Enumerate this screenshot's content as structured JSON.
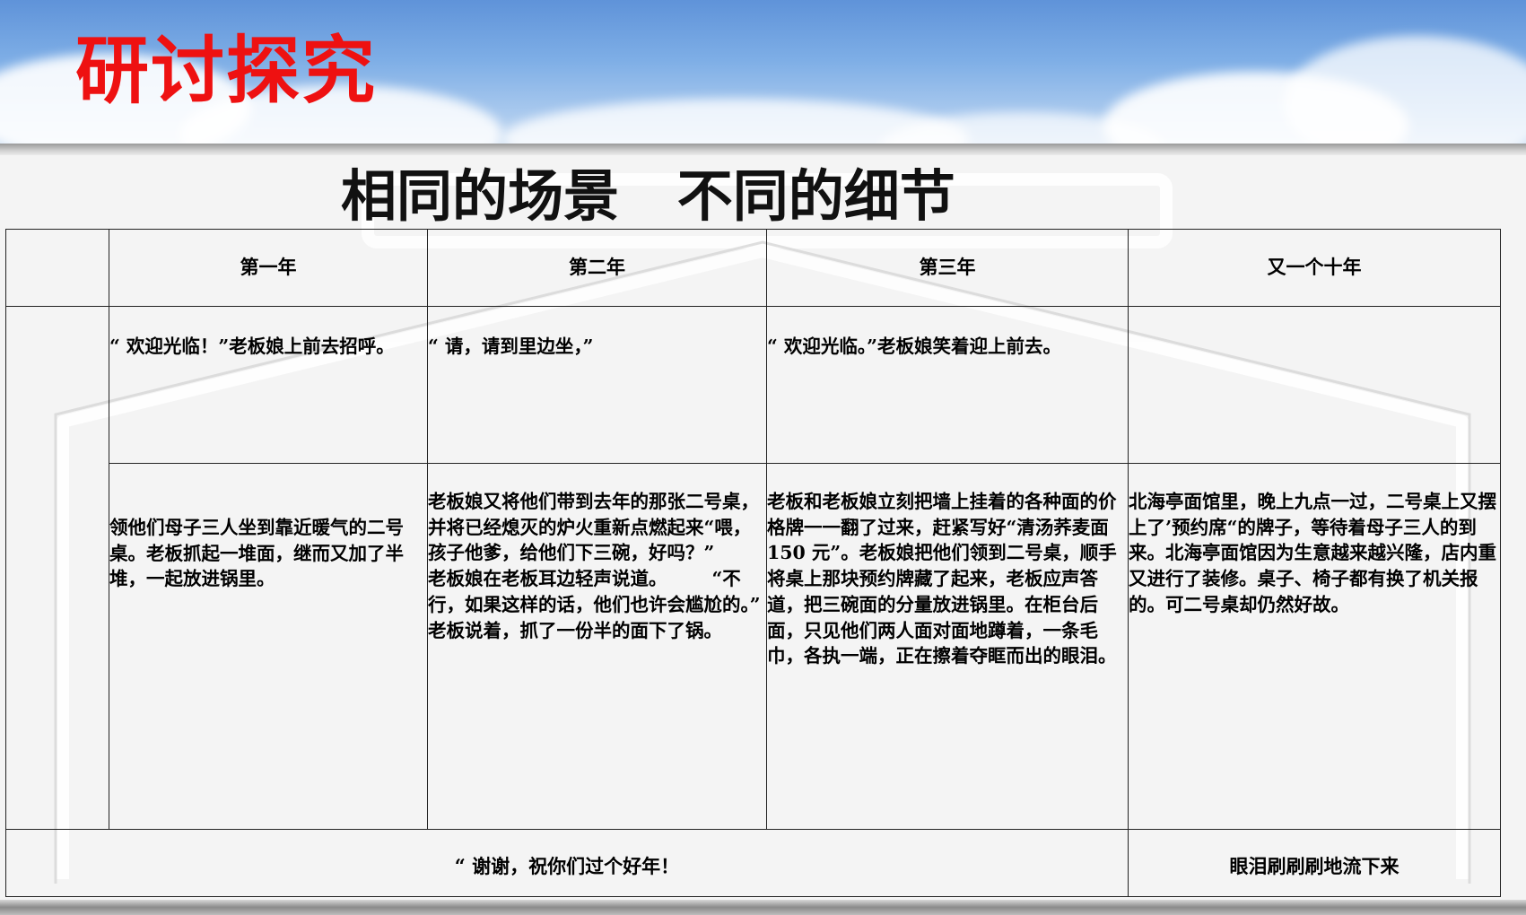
{
  "slide": {
    "title": "研讨探究",
    "subtitle": "相同的场景   不同的细节"
  },
  "table": {
    "headers": [
      "第一年",
      "第二年",
      "第三年",
      "又一个十年"
    ],
    "rows": [
      [
        "“ 欢迎光临！”老板娘上前去招呼。",
        "“ 请，请到里边坐，”",
        "“ 欢迎光临。”老板娘笑着迎上前去。",
        ""
      ],
      [
        "领他们母子三人坐到靠近暖气的二号桌。老板抓起一堆面，继而又加了半堆，一起放进锅里。",
        "老板娘又将他们带到去年的那张二号桌，并将已经熄灭的炉火重新点燃起来“喂，孩子他爹，给他们下三碗，好吗？”       老板娘在老板耳边轻声说道。       “不行，如果这样的话，他们也许会尴尬的。”        老板说着，抓了一份半的面下了锅。",
        "老板和老板娘立刻把墙上挂着的各种面的价格牌一一翻了过来，赶紧写好“清汤荞麦面 150 元”。老板娘把他们领到二号桌，顺手将桌上那块预约牌藏了起来，老板应声答道，把三碗面的分量放进锅里。在柜台后面，只见他们两人面对面地蹲着，一条毛巾，各执一端，正在擦着夺眶而出的眼泪。",
        "北海亭面馆里，晚上九点一过，二号桌上又摆上了’预约席“的牌子，等待着母子三人的到来。北海亭面馆因为生意越来越兴隆，店内重又进行了装修。桌子、椅子都有换了机关报的。可二号桌却仍然好故。"
      ]
    ],
    "footer": [
      "“ 谢谢，祝你们过个好年！",
      "眼泪刷刷刷地流下来"
    ]
  },
  "colors": {
    "title": "#ee1111",
    "text": "#000000",
    "border": "#222222"
  }
}
